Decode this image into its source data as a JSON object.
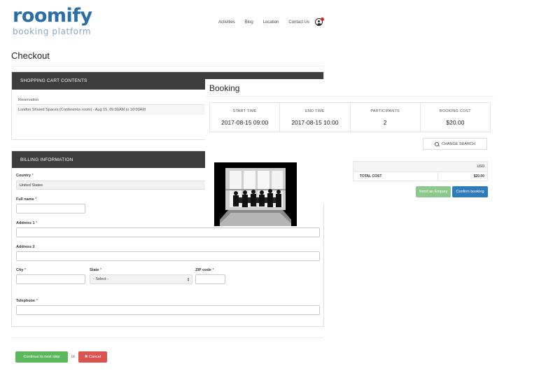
{
  "header": {
    "logo_main": "roomify",
    "logo_sub": "booking platform",
    "nav": [
      "Activities",
      "Blog",
      "Location",
      "Contact Us"
    ],
    "avatar_icon": "user-avatar-icon",
    "notification_color": "#d62b2b"
  },
  "page": {
    "title": "Checkout"
  },
  "cart": {
    "heading": "SHOPPING CART CONTENTS",
    "column_header": "Reservation",
    "row": "London Shared Spaces (Conference room) - Aug 15, 09:00AM to 10:00AM"
  },
  "billing": {
    "heading": "BILLING INFORMATION",
    "country_label": "Country",
    "country_value": "United States",
    "full_name_label": "Full name",
    "address1_label": "Address 1",
    "address2_label": "Address 2",
    "city_label": "City",
    "state_label": "State",
    "state_value": "- Select -",
    "zip_label": "ZIP code",
    "telephone_label": "Telephone",
    "required_mark": "*"
  },
  "actions": {
    "continue_label": "Continue to next step",
    "or_text": "or",
    "cancel_label": "✖ Cancel"
  },
  "booking": {
    "title": "Booking",
    "stats": [
      {
        "label": "START TIME",
        "value": "2017-08-15 09:00"
      },
      {
        "label": "END TIME",
        "value": "2017-08-15 10:00"
      },
      {
        "label": "PARTICIPANTS",
        "value": "2"
      },
      {
        "label": "BOOKING COST",
        "value": "$20.00"
      }
    ],
    "change_search_label": "CHANGE SEARCH",
    "currency": "USD",
    "total_label": "TOTAL COST",
    "total_value": "$20.00",
    "enquiry_label": "Send an Enquiry",
    "confirm_label": "Confirm booking"
  },
  "colors": {
    "brand": "#2a6fa8",
    "panel_header": "#3d3d3d",
    "continue": "#5cb85c",
    "cancel": "#d9534f",
    "confirm": "#2f7bb9",
    "enquiry": "#8dc78d"
  }
}
